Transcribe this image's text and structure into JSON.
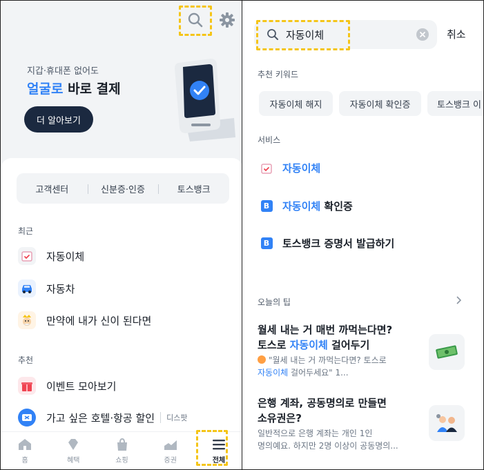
{
  "left": {
    "banner": {
      "small_text": "지갑·휴대폰 없어도",
      "title_part1": "얼굴로",
      "title_part2": " 바로 결제",
      "cta": "더 알아보기"
    },
    "quick_links": [
      "고객센터",
      "신분증·인증",
      "토스뱅크"
    ],
    "recent": {
      "label": "최근",
      "items": [
        "자동이체",
        "자동차",
        "만약에 내가 신이 된다면"
      ]
    },
    "recommend": {
      "label": "추천",
      "items": [
        {
          "label": "이벤트 모아보기",
          "sub": ""
        },
        {
          "label": "가고 싶은 호텔·항공 할인",
          "sub": "디스팟"
        }
      ]
    },
    "tabbar": [
      "홈",
      "혜택",
      "쇼핑",
      "증권",
      "전체"
    ]
  },
  "right": {
    "search": {
      "value": "자동이체",
      "cancel": "취소"
    },
    "keywords": {
      "label": "추천 키워드",
      "chips": [
        "자동이체 해지",
        "자동이체 확인증",
        "토스뱅크 이"
      ]
    },
    "services": {
      "label": "서비스",
      "items": [
        {
          "highlight": "자동이체",
          "rest": ""
        },
        {
          "highlight": "자동이체",
          "rest": " 확인증"
        },
        {
          "highlight": "",
          "rest": "토스뱅크 증명서 발급하기"
        }
      ]
    },
    "tips": {
      "label": "오늘의 팁",
      "items": [
        {
          "title1": "월세 내는 거 매번 까먹는다면?",
          "title2a": "토스로 ",
          "title2b": "자동이체",
          "title2c": " 걸어두기",
          "desc1": "\"월세 내는 거 까먹는다면? 토스로",
          "desc2a": "자동이체",
          "desc2b": " 걸어두세요\" 1..."
        },
        {
          "title1": "은행 계좌, 공동명의로 만들면",
          "title2": "소유권은?",
          "desc1": "일반적으로 은행 계좌는 개인 1인",
          "desc2": "명의예요. 하지만 2명 이상이 공동명의..."
        }
      ]
    }
  },
  "colors": {
    "accent": "#3182f6",
    "highlight": "#f5c518",
    "dark_button": "#1b2940"
  }
}
